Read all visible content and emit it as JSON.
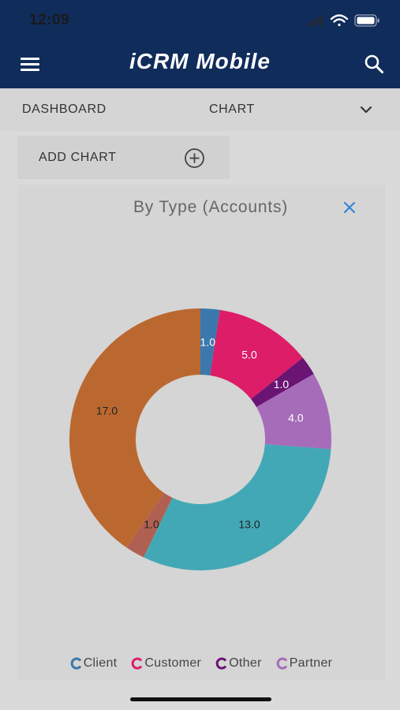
{
  "status_bar": {
    "time": "12:09"
  },
  "header": {
    "title": "iCRM Mobile",
    "menu_icon": "hamburger-icon",
    "search_icon": "search-icon"
  },
  "nav": {
    "dashboard_label": "DASHBOARD",
    "chart_label": "CHART",
    "dropdown_icon": "chevron-down-icon"
  },
  "add_chart": {
    "label": "ADD CHART",
    "icon": "plus-circle-icon"
  },
  "card": {
    "close_icon": "close-icon"
  },
  "colors": {
    "header_bg": "#102c5b",
    "client": "#3a78ad",
    "customer": "#dd1d68",
    "other": "#6a1474",
    "partner": "#a66cb9",
    "teal": "#43a8b6",
    "rust": "#bb6830",
    "brick": "#b06052"
  },
  "chart_data": {
    "type": "pie",
    "style": "donut",
    "title": "By Type (Accounts)",
    "slices": [
      {
        "value": 1.0,
        "label": "1.0",
        "color": "#3a78ad"
      },
      {
        "value": 5.0,
        "label": "5.0",
        "color": "#dd1d68"
      },
      {
        "value": 1.0,
        "label": "1.0",
        "color": "#6a1474"
      },
      {
        "value": 4.0,
        "label": "4.0",
        "color": "#a66cb9"
      },
      {
        "value": 13.0,
        "label": "13.0",
        "color": "#43a8b6"
      },
      {
        "value": 1.0,
        "label": "1.0",
        "color": "#b06052"
      },
      {
        "value": 17.0,
        "label": "17.0",
        "color": "#bb6830"
      }
    ],
    "legend": [
      {
        "name": "Client",
        "color": "#3a78ad"
      },
      {
        "name": "Customer",
        "color": "#dd1d68"
      },
      {
        "name": "Other",
        "color": "#6a1474"
      },
      {
        "name": "Partner",
        "color": "#a66cb9"
      }
    ],
    "legend_position": "bottom"
  }
}
